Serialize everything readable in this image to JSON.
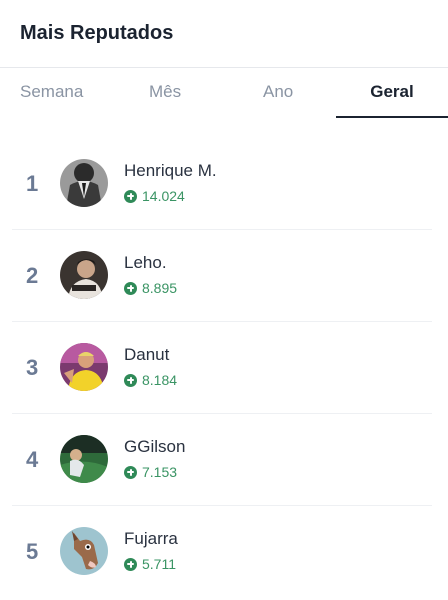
{
  "header": {
    "title": "Mais Reputados"
  },
  "tabs": [
    {
      "label": "Semana",
      "active": false
    },
    {
      "label": "Mês",
      "active": false
    },
    {
      "label": "Ano",
      "active": false
    },
    {
      "label": "Geral",
      "active": true
    }
  ],
  "colors": {
    "accent_text": "#1b2330",
    "score_green": "#3a9464",
    "rank_grey": "#6b7a94"
  },
  "leaderboard": [
    {
      "rank": "1",
      "name": "Henrique M.",
      "score": "14.024",
      "avatar_icon": "avatar-suit-icon"
    },
    {
      "rank": "2",
      "name": "Leho.",
      "score": "8.895",
      "avatar_icon": "avatar-person-icon"
    },
    {
      "rank": "3",
      "name": "Danut",
      "score": "8.184",
      "avatar_icon": "avatar-player-icon"
    },
    {
      "rank": "4",
      "name": "GGilson",
      "score": "7.153",
      "avatar_icon": "avatar-field-icon"
    },
    {
      "rank": "5",
      "name": "Fujarra",
      "score": "5.711",
      "avatar_icon": "avatar-horse-icon"
    }
  ]
}
